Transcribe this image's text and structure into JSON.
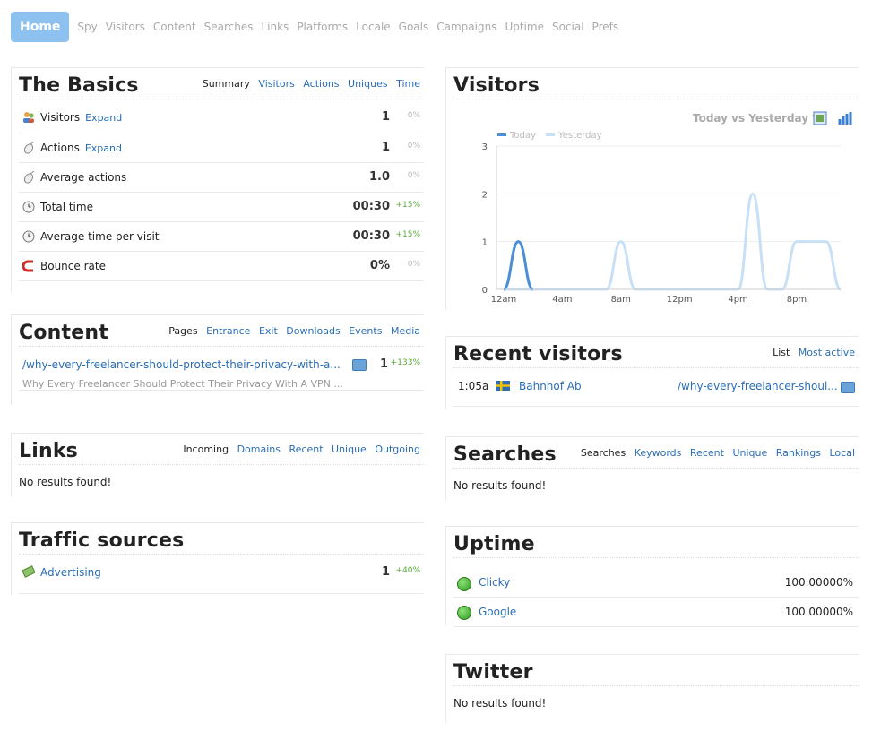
{
  "nav": {
    "home": "Home",
    "items": [
      "Spy",
      "Visitors",
      "Content",
      "Searches",
      "Links",
      "Platforms",
      "Locale",
      "Goals",
      "Campaigns",
      "Uptime",
      "Social",
      "Prefs"
    ]
  },
  "basics": {
    "title": "The Basics",
    "tabs": [
      "Summary",
      "Visitors",
      "Actions",
      "Uniques",
      "Time"
    ],
    "rows": [
      {
        "icon": "visitors-icon",
        "label": "Visitors",
        "expand": "Expand",
        "value": "1",
        "change": "0%"
      },
      {
        "icon": "actions-icon",
        "label": "Actions",
        "expand": "Expand",
        "value": "1",
        "change": "0%"
      },
      {
        "icon": "actions-icon",
        "label": "Average actions",
        "expand": "",
        "value": "1.0",
        "change": "0%"
      },
      {
        "icon": "clock-icon",
        "label": "Total time",
        "expand": "",
        "value": "00:30",
        "change": "+15%"
      },
      {
        "icon": "clock-icon",
        "label": "Average time per visit",
        "expand": "",
        "value": "00:30",
        "change": "+15%"
      },
      {
        "icon": "bounce-icon",
        "label": "Bounce rate",
        "expand": "",
        "value": "0%",
        "change": "0%"
      }
    ]
  },
  "content": {
    "title": "Content",
    "tabs": [
      "Pages",
      "Entrance",
      "Exit",
      "Downloads",
      "Events",
      "Media"
    ],
    "item": {
      "url": "/why-every-freelancer-should-protect-their-privacy-with-a...",
      "subtitle": "Why Every Freelancer Should Protect Their Privacy With A VPN ...",
      "value": "1",
      "change": "+133%"
    }
  },
  "links": {
    "title": "Links",
    "tabs": [
      "Incoming",
      "Domains",
      "Recent",
      "Unique",
      "Outgoing"
    ],
    "empty": "No results found!"
  },
  "traffic": {
    "title": "Traffic sources",
    "row": {
      "label": "Advertising",
      "value": "1",
      "change": "+40%"
    }
  },
  "visitors_chart": {
    "title": "Visitors",
    "compare": "Today vs Yesterday ▼",
    "legend": [
      "Today",
      "Yesterday"
    ]
  },
  "chart_data": {
    "type": "line",
    "x": [
      "12am",
      "1am",
      "2am",
      "3am",
      "4am",
      "5am",
      "6am",
      "7am",
      "8am",
      "9am",
      "10am",
      "11am",
      "12pm",
      "1pm",
      "2pm",
      "3pm",
      "4pm",
      "5pm",
      "6pm",
      "7pm",
      "8pm",
      "9pm",
      "10pm",
      "11pm"
    ],
    "xticks": [
      "12am",
      "4am",
      "8am",
      "12pm",
      "4pm",
      "8pm"
    ],
    "series": [
      {
        "name": "Today",
        "color": "#4a8fd6",
        "values": [
          0,
          1,
          0
        ]
      },
      {
        "name": "Yesterday",
        "color": "#c8e0f6",
        "values": [
          0,
          0,
          0,
          0,
          0,
          0,
          0,
          0,
          1,
          0,
          0,
          0,
          0,
          0,
          0,
          0,
          0,
          2,
          0,
          0,
          1,
          1,
          1,
          0
        ]
      }
    ],
    "ylim": [
      0,
      3
    ],
    "yticks": [
      0,
      1,
      2,
      3
    ],
    "legend_position": "top-left",
    "grid": true
  },
  "recent": {
    "title": "Recent visitors",
    "tabs": [
      "List",
      "Most active"
    ],
    "row": {
      "time": "1:05a",
      "org": "Bahnhof Ab",
      "url": "/why-every-freelancer-shoul..."
    }
  },
  "searches": {
    "title": "Searches",
    "tabs": [
      "Searches",
      "Keywords",
      "Recent",
      "Unique",
      "Rankings",
      "Local"
    ],
    "empty": "No results found!"
  },
  "uptime": {
    "title": "Uptime",
    "rows": [
      {
        "label": "Clicky",
        "value": "100.00000%"
      },
      {
        "label": "Google",
        "value": "100.00000%"
      }
    ]
  },
  "twitter": {
    "title": "Twitter",
    "empty": "No results found!"
  }
}
